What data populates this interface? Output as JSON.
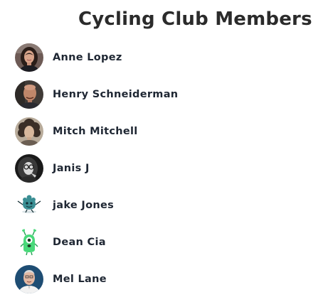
{
  "header": {
    "title": "Cycling Club Members"
  },
  "members": [
    {
      "name": "Anne Lopez",
      "avatar": "photo-woman-dark-hair-icon"
    },
    {
      "name": "Henry Schneiderman",
      "avatar": "photo-bald-man-icon"
    },
    {
      "name": "Mitch Mitchell",
      "avatar": "photo-curly-hair-man-icon"
    },
    {
      "name": "Janis J",
      "avatar": "photo-bw-woman-glasses-icon"
    },
    {
      "name": "jake Jones",
      "avatar": "cartoon-teal-monster-icon"
    },
    {
      "name": "Dean Cia",
      "avatar": "cartoon-green-alien-icon"
    },
    {
      "name": "Mel Lane",
      "avatar": "photo-older-man-icon"
    }
  ],
  "colors": {
    "title": "#2b2b2b",
    "name": "#1f2733",
    "background": "#ffffff"
  }
}
